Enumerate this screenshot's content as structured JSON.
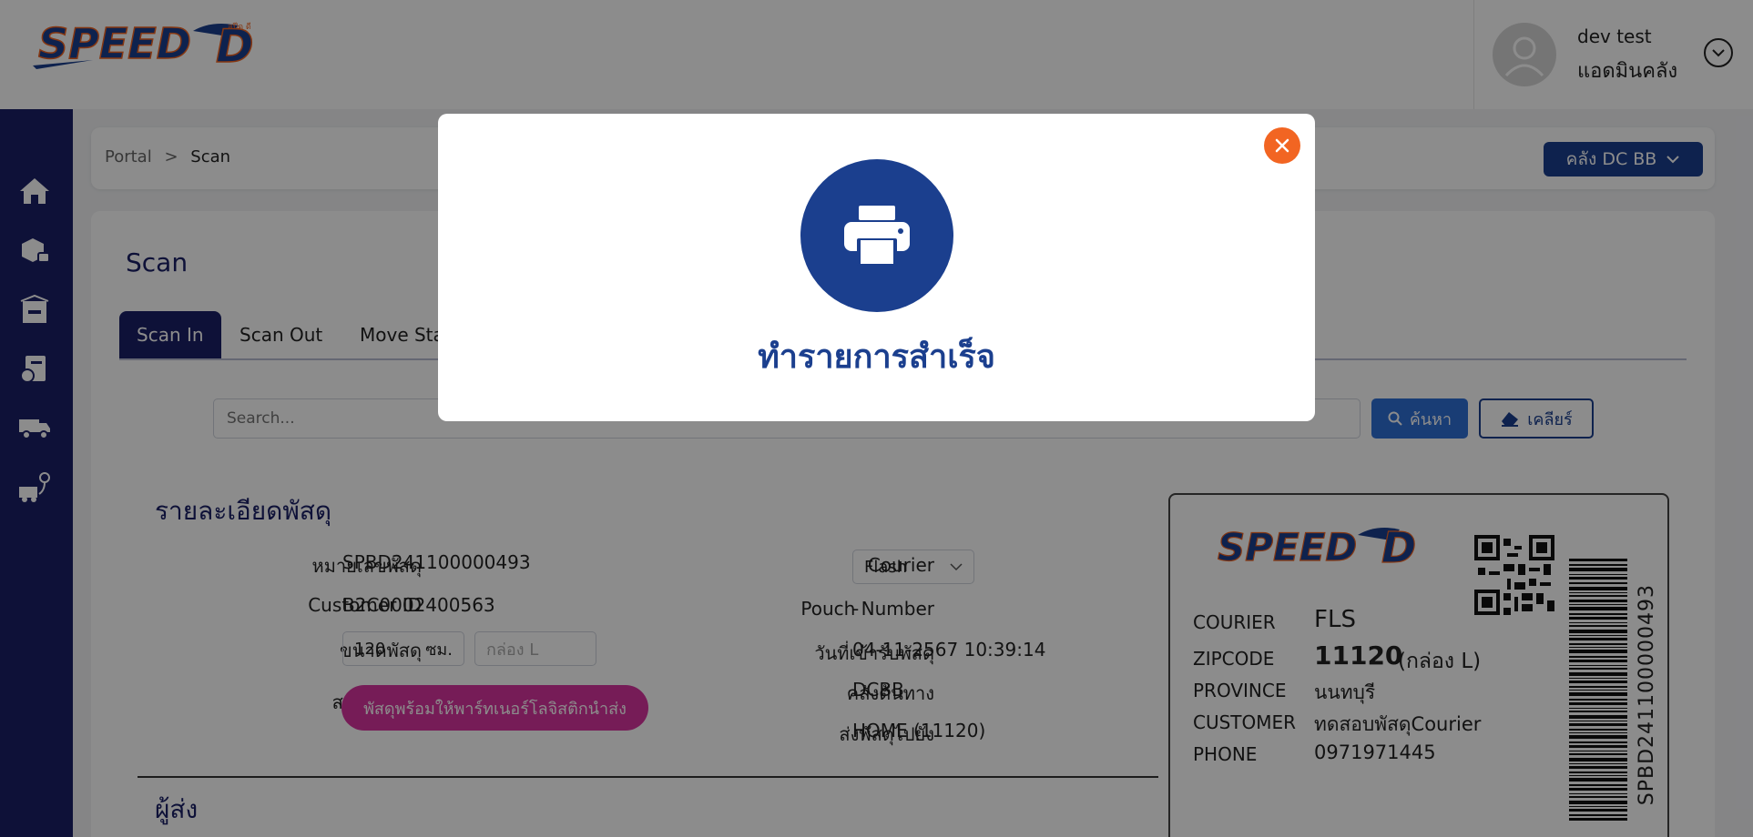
{
  "header": {
    "logo_text": "SPEED D",
    "logo_badge": "สปีด ดี",
    "user_name": "dev test",
    "user_role": "แอดมินคลัง",
    "icons": [
      "avatar-icon",
      "chevron-down-icon"
    ]
  },
  "sidebar": {
    "items": [
      {
        "name": "home",
        "icon": "home-icon"
      },
      {
        "name": "parcel",
        "icon": "parcel-icon"
      },
      {
        "name": "warehouse",
        "icon": "warehouse-icon"
      },
      {
        "name": "document",
        "icon": "document-icon"
      },
      {
        "name": "truck",
        "icon": "truck-icon"
      },
      {
        "name": "route",
        "icon": "route-icon"
      }
    ]
  },
  "breadcrumb": {
    "root": "Portal",
    "separator": ">",
    "current": "Scan"
  },
  "warehouse_selector": {
    "label": "คลัง DC BB"
  },
  "page": {
    "title": "Scan",
    "tabs": [
      {
        "label": "Scan In",
        "active": true
      },
      {
        "label": "Scan Out",
        "active": false
      },
      {
        "label": "Move Sta",
        "active": false
      }
    ]
  },
  "search": {
    "placeholder": "Search...",
    "search_label": "ค้นหา",
    "clear_label": "เคลียร์"
  },
  "parcel_detail": {
    "section_title": "รายละเอียดพัสดุ",
    "tracking_label": "หมายเลขพัสดุ",
    "tracking_value": "SPBD241100000493",
    "customer_id_label": "Customer ID",
    "customer_id_value": "B2C0002400563",
    "size_label": "ขนาดพัสดุ",
    "size_value": "120",
    "size_unit": "ซม.",
    "box_placeholder": "กล่อง L",
    "status_label": "สถานะพัสดุ",
    "status_value": "พัสดุพร้อมให้พาร์ทเนอร์โลจิสติกนำส่ง",
    "courier_label": "Courier",
    "courier_value": "Flash",
    "pouch_label": "Pouch Number",
    "pouch_value": "-",
    "received_label": "วันที่เข้ารับพัสดุ",
    "received_value": "04-11-2567 10:39:14",
    "origin_label": "คลังต้นทาง",
    "origin_value": "DCBB",
    "destination_label": "ส่งพัสดุไปยัง",
    "destination_value": "HOME (11120)"
  },
  "sender": {
    "section_title": "ผู้ส่ง"
  },
  "shipping_label": {
    "courier_key": "COURIER",
    "courier_value": "FLS",
    "zipcode_key": "ZIPCODE",
    "zipcode_value": "11120",
    "zipcode_box": "(กล่อง L)",
    "province_key": "PROVINCE",
    "province_value": "นนทบุรี",
    "customer_key": "CUSTOMER",
    "customer_value": "ทดสอบพัสดุCourier",
    "phone_key": "PHONE",
    "phone_value": "0971971445",
    "barcode_text": "SPBD241100000493"
  },
  "modal": {
    "message": "ทำรายการสำเร็จ",
    "icon": "printer-icon",
    "close_icon": "close-icon"
  },
  "colors": {
    "brand_navy": "#1b2066",
    "brand_blue": "#1b3f8e",
    "accent_orange": "#f26522",
    "status_pink": "#d8339e"
  }
}
